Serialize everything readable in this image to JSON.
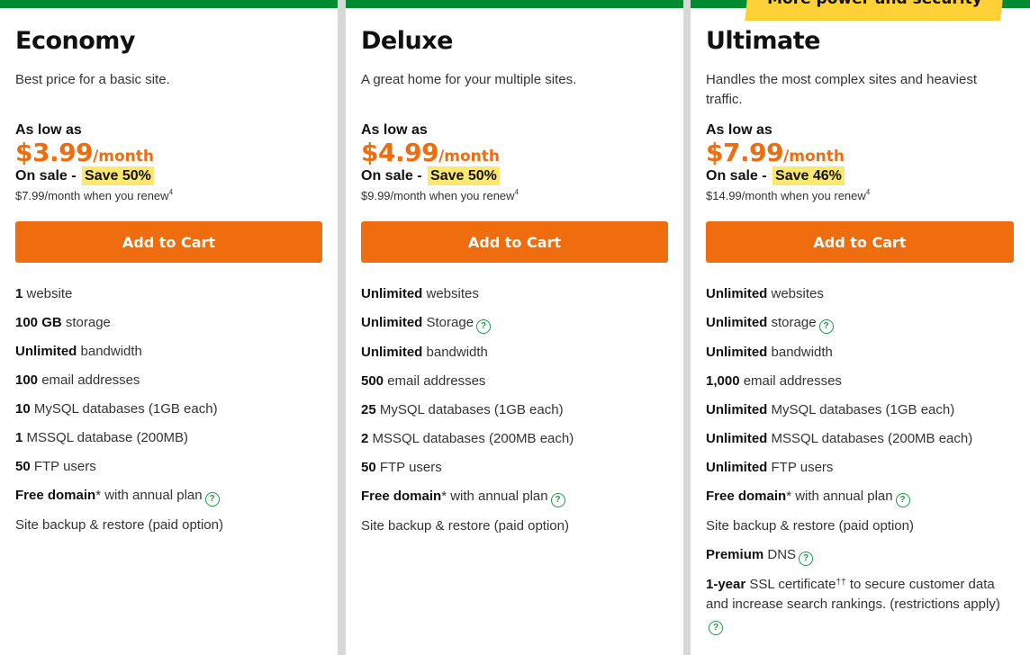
{
  "ribbon": "More power and security",
  "plans": [
    {
      "name": "Economy",
      "tagline": "Best price for a basic site.",
      "low_label": "As low as",
      "price": "$3.99",
      "period": "/month",
      "sale_label": "On sale -",
      "save": "Save 50%",
      "renew": "$7.99/month when you renew",
      "renew_note": "4",
      "cta": "Add to Cart",
      "features": [
        {
          "bold": "1",
          "text": " website"
        },
        {
          "bold": "100 GB",
          "text": " storage"
        },
        {
          "bold": "Unlimited",
          "text": " bandwidth"
        },
        {
          "bold": "100",
          "text": " email addresses"
        },
        {
          "bold": "10",
          "text": " MySQL databases (1GB each)"
        },
        {
          "bold": "1",
          "text": " MSSQL database (200MB)"
        },
        {
          "bold": "50",
          "text": " FTP users"
        },
        {
          "bold": "Free domain",
          "text": "* with annual plan"
        },
        {
          "bold": "",
          "text": "Site backup & restore (paid option)"
        }
      ]
    },
    {
      "name": "Deluxe",
      "tagline": "A great home for your multiple sites.",
      "low_label": "As low as",
      "price": "$4.99",
      "period": "/month",
      "sale_label": "On sale -",
      "save": "Save 50%",
      "renew": "$9.99/month when you renew",
      "renew_note": "4",
      "cta": "Add to Cart",
      "features": [
        {
          "bold": "Unlimited",
          "text": " websites"
        },
        {
          "bold": "Unlimited",
          "text": " Storage"
        },
        {
          "bold": "Unlimited",
          "text": " bandwidth"
        },
        {
          "bold": "500",
          "text": " email addresses"
        },
        {
          "bold": "25",
          "text": " MySQL databases (1GB each)"
        },
        {
          "bold": "2",
          "text": " MSSQL databases (200MB each)"
        },
        {
          "bold": "50",
          "text": " FTP users"
        },
        {
          "bold": "Free domain",
          "text": "* with annual plan"
        },
        {
          "bold": "",
          "text": "Site backup & restore (paid option)"
        }
      ]
    },
    {
      "name": "Ultimate",
      "tagline": "Handles the most complex sites and heaviest traffic.",
      "low_label": "As low as",
      "price": "$7.99",
      "period": "/month",
      "sale_label": "On sale -",
      "save": "Save 46%",
      "renew": "$14.99/month when you renew",
      "renew_note": "4",
      "cta": "Add to Cart",
      "features": [
        {
          "bold": "Unlimited",
          "text": " websites"
        },
        {
          "bold": "Unlimited",
          "text": " storage"
        },
        {
          "bold": "Unlimited",
          "text": " bandwidth"
        },
        {
          "bold": "1,000",
          "text": " email addresses"
        },
        {
          "bold": "Unlimited",
          "text": " MySQL databases (1GB each)"
        },
        {
          "bold": "Unlimited",
          "text": " MSSQL databases (200MB each)"
        },
        {
          "bold": "Unlimited",
          "text": " FTP users"
        },
        {
          "bold": "Free domain",
          "text": "* with annual plan"
        },
        {
          "bold": "",
          "text": "Site backup & restore (paid option)"
        },
        {
          "bold": "Premium",
          "text": " DNS"
        },
        {
          "bold": "1-year",
          "text": " SSL certificate",
          "sup": "††",
          "text2": " to secure customer data and increase search rankings. (restrictions apply)"
        }
      ]
    }
  ],
  "colors": {
    "brand_green": "#008a32",
    "price_orange": "#ef6c0f",
    "save_highlight": "#fde86f",
    "ribbon_yellow": "#fed136",
    "help_icon": "#1a9a44"
  },
  "icons": {
    "help": "question-circle-icon"
  }
}
